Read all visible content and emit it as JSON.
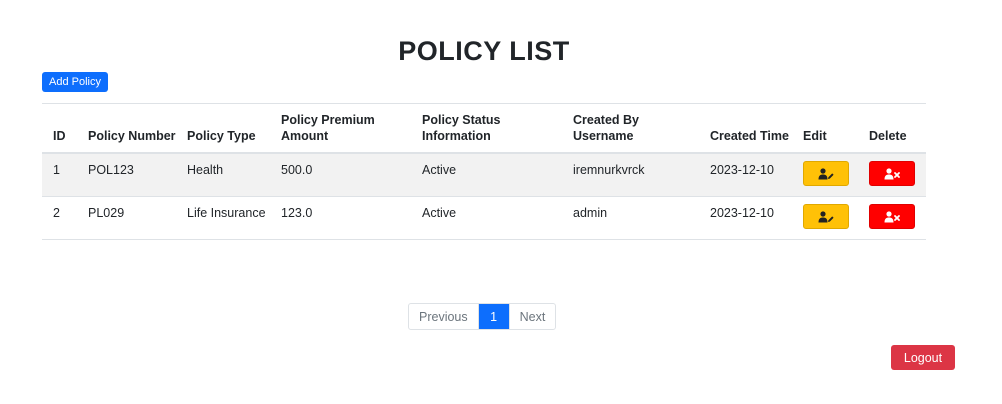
{
  "page": {
    "title": "POLICY LIST"
  },
  "toolbar": {
    "add_label": "Add Policy"
  },
  "table": {
    "headers": {
      "id": "ID",
      "policy_number": "Policy Number",
      "policy_type": "Policy Type",
      "premium": "Policy Premium Amount",
      "status": "Policy Status Information",
      "created_by": "Created By Username",
      "created_time": "Created Time",
      "edit": "Edit",
      "delete": "Delete"
    },
    "rows": [
      {
        "id": "1",
        "policy_number": "POL123",
        "policy_type": "Health",
        "premium": "500.0",
        "status": "Active",
        "created_by": "iremnurkvrck",
        "created_time": "2023-12-10"
      },
      {
        "id": "2",
        "policy_number": "PL029",
        "policy_type": "Life Insurance",
        "premium": "123.0",
        "status": "Active",
        "created_by": "admin",
        "created_time": "2023-12-10"
      }
    ],
    "icons": {
      "edit": "user-edit-icon",
      "delete": "user-delete-icon"
    }
  },
  "pagination": {
    "previous": "Previous",
    "current": "1",
    "next": "Next"
  },
  "footer": {
    "logout_label": "Logout"
  },
  "colors": {
    "primary": "#0d6efd",
    "edit": "#ffc107",
    "delete": "#ff0000",
    "logout": "#dc3545"
  }
}
